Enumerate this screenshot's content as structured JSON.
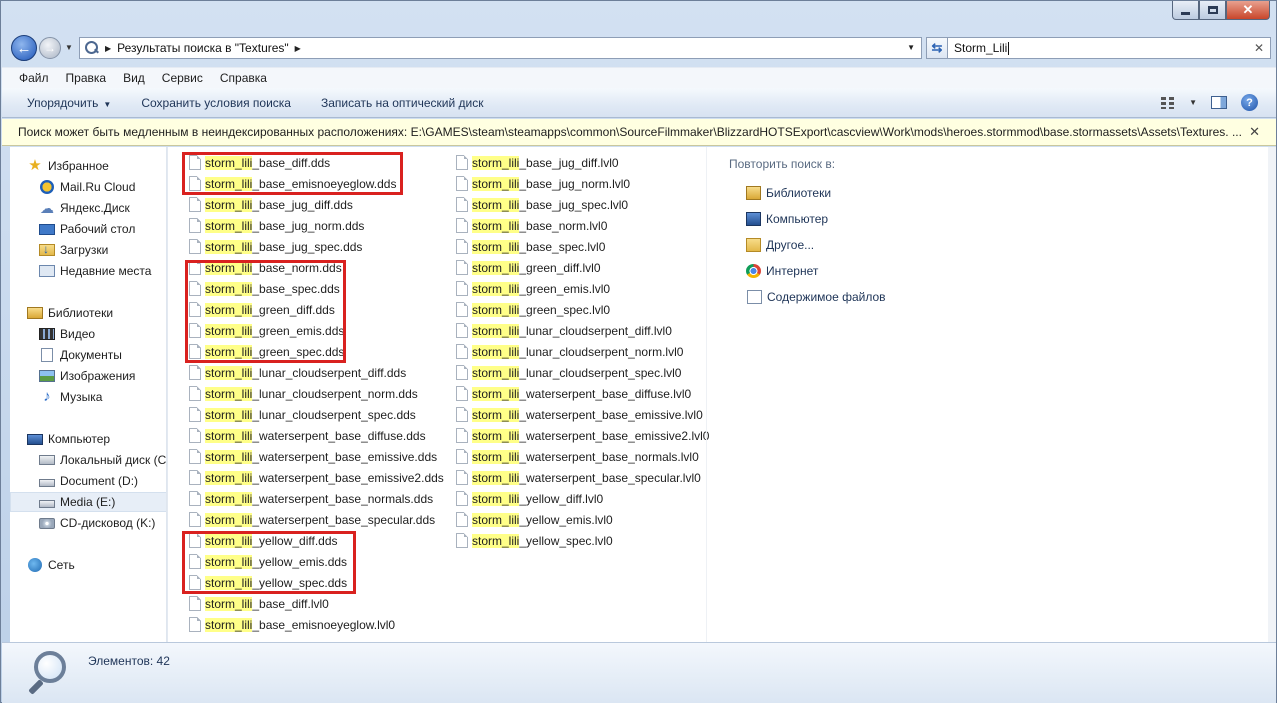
{
  "window": {
    "minimize_label": "—",
    "close_label": "✕"
  },
  "address": {
    "breadcrumb": "Результаты поиска в \"Textures\"",
    "search_value": "Storm_Lili"
  },
  "menu": [
    "Файл",
    "Правка",
    "Вид",
    "Сервис",
    "Справка"
  ],
  "commands": {
    "organize": "Упорядочить",
    "save_search": "Сохранить условия поиска",
    "burn": "Записать на оптический диск"
  },
  "infobar": {
    "text": "Поиск может быть медленным в неиндексированных расположениях: E:\\GAMES\\steam\\steamapps\\common\\SourceFilmmaker\\BlizzardHOTSExport\\cascview\\Work\\mods\\heroes.stormmod\\base.stormassets\\Assets\\Textures. ..."
  },
  "nav": {
    "favorites": "Избранное",
    "mailru": "Mail.Ru Cloud",
    "yadisk": "Яндекс.Диск",
    "desktop": "Рабочий стол",
    "downloads": "Загрузки",
    "recent": "Недавние места",
    "libraries": "Библиотеки",
    "video": "Видео",
    "documents": "Документы",
    "images": "Изображения",
    "music": "Музыка",
    "computer": "Компьютер",
    "local_disk": "Локальный диск (C",
    "document_d": "Document (D:)",
    "media_e": "Media (E:)",
    "cd_k": "CD-дисковод (K:)",
    "network": "Сеть"
  },
  "files": {
    "match": "storm_lili",
    "col1": [
      "_base_diff.dds",
      "_base_emisnoeyeglow.dds",
      "_base_jug_diff.dds",
      "_base_jug_norm.dds",
      "_base_jug_spec.dds",
      "_base_norm.dds",
      "_base_spec.dds",
      "_green_diff.dds",
      "_green_emis.dds",
      "_green_spec.dds",
      "_lunar_cloudserpent_diff.dds",
      "_lunar_cloudserpent_norm.dds",
      "_lunar_cloudserpent_spec.dds",
      "_waterserpent_base_diffuse.dds",
      "_waterserpent_base_emissive.dds",
      "_waterserpent_base_emissive2.dds",
      "_waterserpent_base_normals.dds",
      "_waterserpent_base_specular.dds",
      "_yellow_diff.dds",
      "_yellow_emis.dds",
      "_yellow_spec.dds",
      "_base_diff.lvl0",
      "_base_emisnoeyeglow.lvl0"
    ],
    "col2": [
      "_base_jug_diff.lvl0",
      "_base_jug_norm.lvl0",
      "_base_jug_spec.lvl0",
      "_base_norm.lvl0",
      "_base_spec.lvl0",
      "_green_diff.lvl0",
      "_green_emis.lvl0",
      "_green_spec.lvl0",
      "_lunar_cloudserpent_diff.lvl0",
      "_lunar_cloudserpent_norm.lvl0",
      "_lunar_cloudserpent_spec.lvl0",
      "_waterserpent_base_diffuse.lvl0",
      "_waterserpent_base_emissive.lvl0",
      "_waterserpent_base_emissive2.lvl0",
      "_waterserpent_base_normals.lvl0",
      "_waterserpent_base_specular.lvl0",
      "_yellow_diff.lvl0",
      "_yellow_emis.lvl0",
      "_yellow_spec.lvl0"
    ]
  },
  "search_again": {
    "heading": "Повторить поиск в:",
    "libraries": "Библиотеки",
    "computer": "Компьютер",
    "other": "Другое...",
    "internet": "Интернет",
    "contents": "Содержимое файлов"
  },
  "status": {
    "count": "Элементов: 42"
  },
  "colors": {
    "highlight": "#ffff88",
    "annotation_box": "#d9211f",
    "infobar": "#ffffe1"
  }
}
